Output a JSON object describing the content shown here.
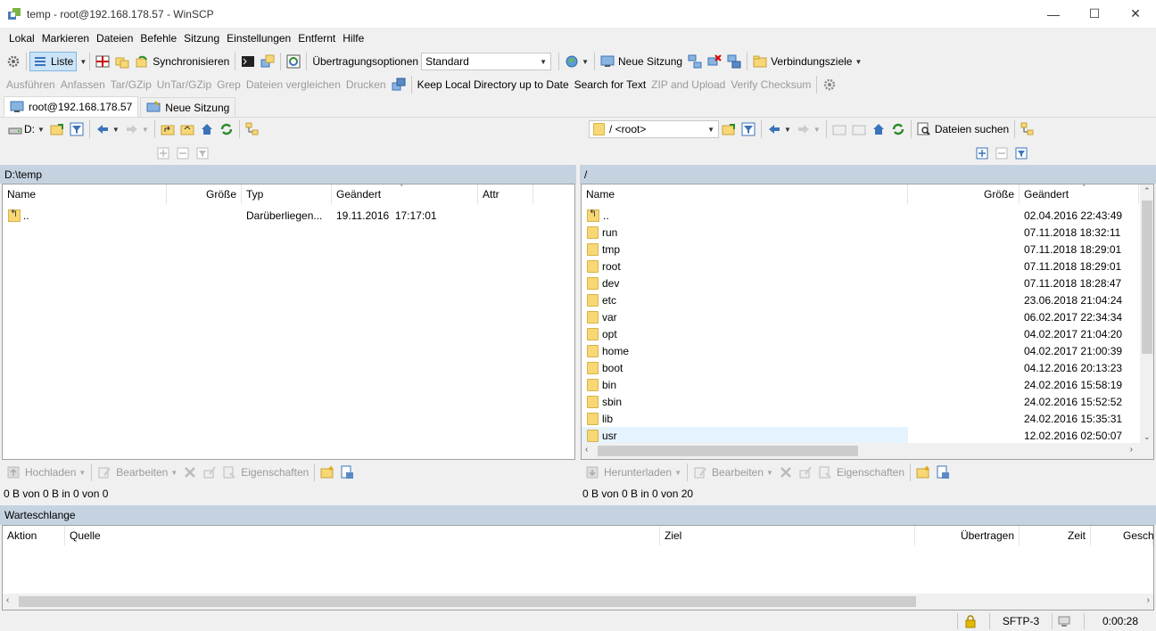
{
  "window": {
    "title": "temp - root@192.168.178.57 - WinSCP",
    "controls": [
      "—",
      "☐",
      "✕"
    ]
  },
  "menu": [
    "Lokal",
    "Markieren",
    "Dateien",
    "Befehle",
    "Sitzung",
    "Einstellungen",
    "Entfernt",
    "Hilfe"
  ],
  "toolbar1": {
    "list_label": "Liste",
    "sync_label": "Synchronisieren",
    "transfer_options_label": "Übertragungsoptionen",
    "transfer_preset": "Standard",
    "new_session_label": "Neue Sitzung",
    "bookmarks_label": "Verbindungsziele"
  },
  "toolbar2": {
    "items": [
      {
        "label": "Ausführen",
        "enabled": false
      },
      {
        "label": "Anfassen",
        "enabled": false
      },
      {
        "label": "Tar/GZip",
        "enabled": false
      },
      {
        "label": "UnTar/GZip",
        "enabled": false
      },
      {
        "label": "Grep",
        "enabled": false
      },
      {
        "label": "Dateien vergleichen",
        "enabled": false
      },
      {
        "label": "Drucken",
        "enabled": false
      }
    ],
    "items_b": [
      {
        "label": "Keep Local Directory up to Date",
        "enabled": true
      },
      {
        "label": "Search for Text",
        "enabled": true
      },
      {
        "label": "ZIP and Upload",
        "enabled": false
      },
      {
        "label": "Verify Checksum",
        "enabled": false
      }
    ]
  },
  "tabs": [
    {
      "label": "root@192.168.178.57",
      "active": true
    },
    {
      "label": "Neue Sitzung",
      "active": false
    }
  ],
  "local": {
    "drive": "D:",
    "path": "D:\\temp",
    "columns": [
      "Name",
      "Größe",
      "Typ",
      "Geändert",
      "Attr"
    ],
    "rows": [
      {
        "name": "..",
        "size": "",
        "type": "Darüberliegen...",
        "changed": "19.11.2016  17:17:01",
        "attr": ""
      }
    ],
    "upload_label": "Hochladen",
    "edit_label": "Bearbeiten",
    "props_label": "Eigenschaften",
    "status": "0 B von 0 B in 0 von 0"
  },
  "remote": {
    "dir_select": "/ <root>",
    "find_label": "Dateien suchen",
    "path": "/",
    "columns": [
      "Name",
      "Größe",
      "Geändert"
    ],
    "rows": [
      {
        "name": "..",
        "changed": "02.04.2016 22:43:49",
        "up": true
      },
      {
        "name": "run",
        "changed": "07.11.2018 18:32:11"
      },
      {
        "name": "tmp",
        "changed": "07.11.2018 18:29:01"
      },
      {
        "name": "root",
        "changed": "07.11.2018 18:29:01"
      },
      {
        "name": "dev",
        "changed": "07.11.2018 18:28:47"
      },
      {
        "name": "etc",
        "changed": "23.06.2018 21:04:24"
      },
      {
        "name": "var",
        "changed": "06.02.2017 22:34:34"
      },
      {
        "name": "opt",
        "changed": "04.02.2017 21:04:20"
      },
      {
        "name": "home",
        "changed": "04.02.2017 21:00:39"
      },
      {
        "name": "boot",
        "changed": "04.12.2016 20:13:23"
      },
      {
        "name": "bin",
        "changed": "24.02.2016 15:58:19"
      },
      {
        "name": "sbin",
        "changed": "24.02.2016 15:52:52"
      },
      {
        "name": "lib",
        "changed": "24.02.2016 15:35:31"
      },
      {
        "name": "usr",
        "changed": "12.02.2016 02:50:07"
      }
    ],
    "download_label": "Herunterladen",
    "edit_label": "Bearbeiten",
    "props_label": "Eigenschaften",
    "status": "0 B von 0 B in 0 von 20"
  },
  "queue": {
    "title": "Warteschlange",
    "columns": [
      "Aktion",
      "Quelle",
      "Ziel",
      "Übertragen",
      "Zeit",
      "Gesch"
    ]
  },
  "statusbar": {
    "protocol": "SFTP-3",
    "elapsed": "0:00:28"
  },
  "colors": {
    "pathbar": "#c5d3e1",
    "folder": "#f8d775",
    "selection": "#e5f3ff"
  }
}
